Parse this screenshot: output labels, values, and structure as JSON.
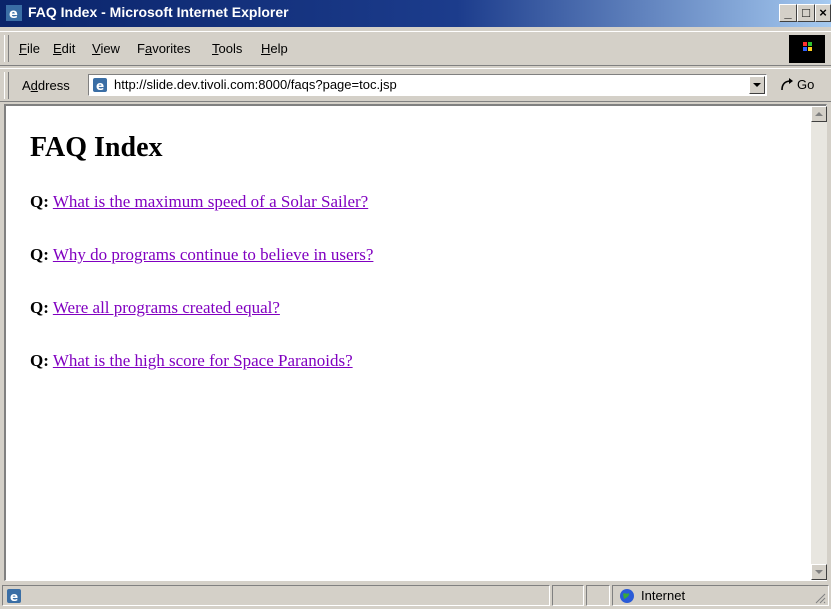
{
  "window": {
    "title": "FAQ Index - Microsoft Internet Explorer",
    "minimize_glyph": "_",
    "maximize_glyph": "□",
    "close_glyph": "×"
  },
  "menu": {
    "items": [
      {
        "accel": "F",
        "rest": "ile"
      },
      {
        "accel": "E",
        "rest": "dit"
      },
      {
        "accel": "V",
        "rest": "iew"
      },
      {
        "pre": "F",
        "accel": "a",
        "rest": "vorites"
      },
      {
        "accel": "T",
        "rest": "ools"
      },
      {
        "accel": "H",
        "rest": "elp"
      }
    ]
  },
  "address": {
    "label_pre": "A",
    "label_accel": "d",
    "label_rest": "dress",
    "url": "http://slide.dev.tivoli.com:8000/faqs?page=toc.jsp",
    "go_label": "Go"
  },
  "page": {
    "title": "FAQ Index",
    "q_label": "Q:",
    "questions": [
      "What is the maximum speed of a Solar Sailer?",
      "Why do programs continue to believe in users?",
      "Were all programs created equal?",
      "What is the high score for Space Paranoids?"
    ]
  },
  "status": {
    "zone": "Internet"
  },
  "colors": {
    "link_visited": "#8000c0",
    "titlebar_start": "#0a246a",
    "titlebar_end": "#a6caf0",
    "chrome": "#d4d0c8"
  },
  "icons": [
    "ie-logo-icon",
    "throbber-logo-icon",
    "go-arrow-icon",
    "chevron-down-icon",
    "globe-icon",
    "resize-grip-icon"
  ]
}
